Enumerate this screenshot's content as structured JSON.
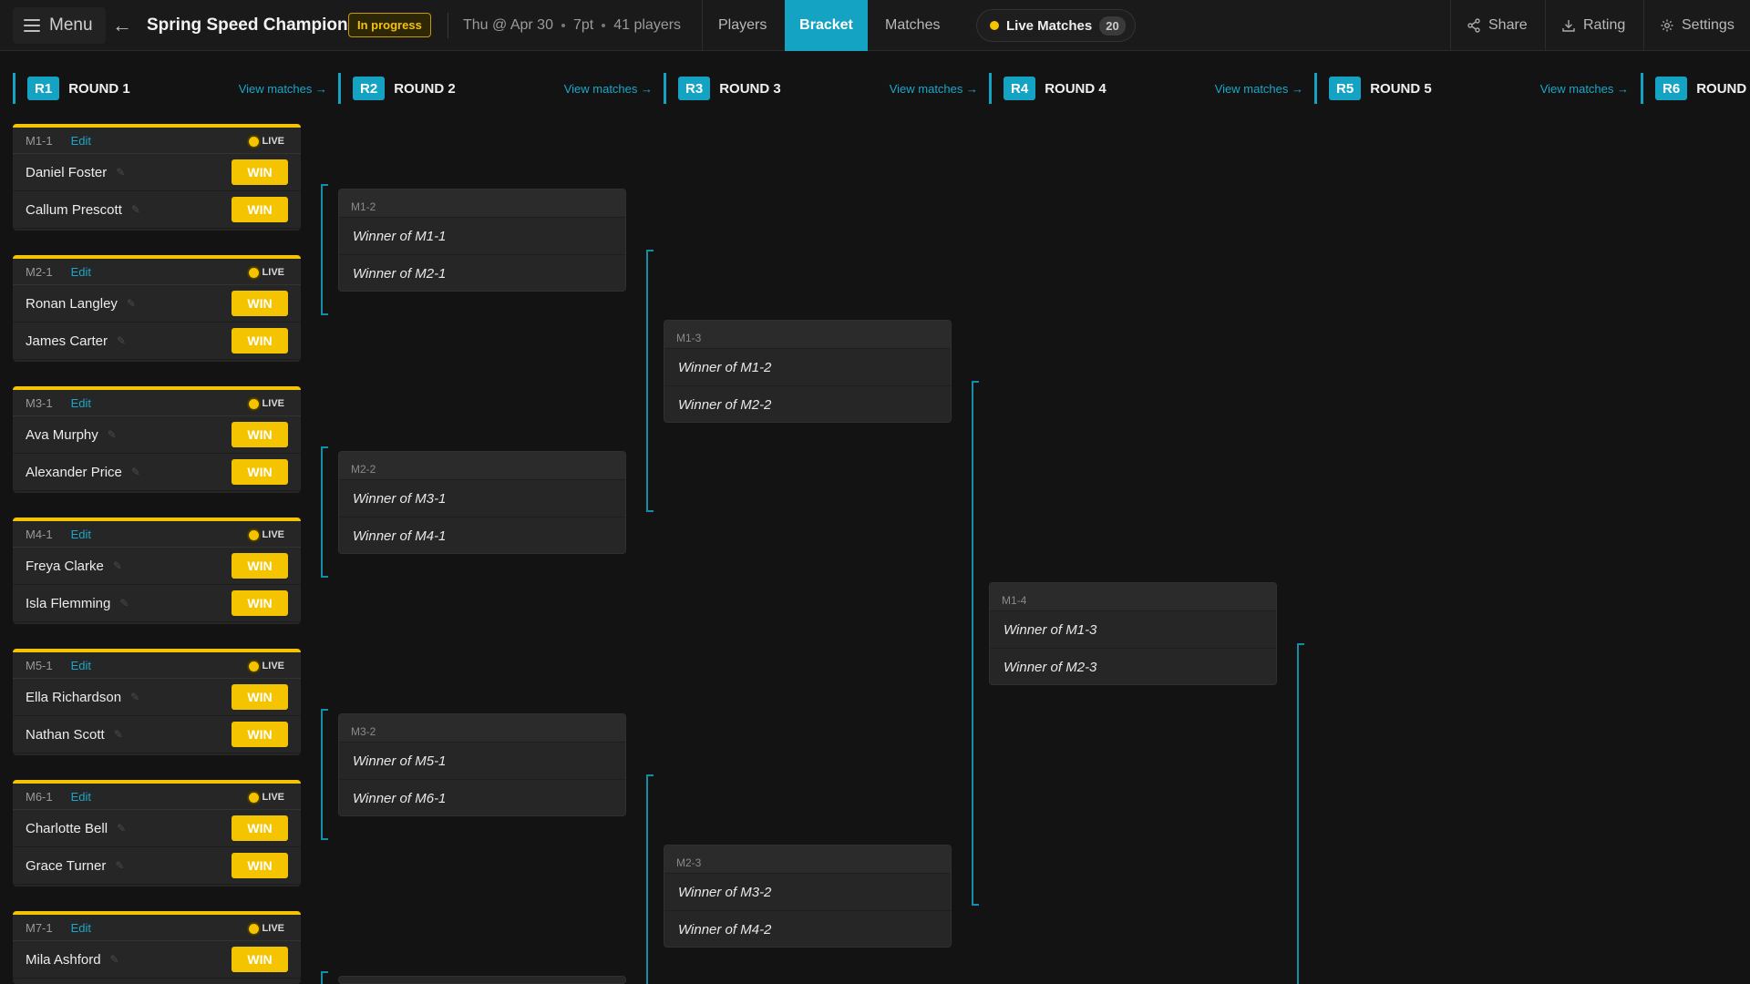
{
  "header": {
    "menu_label": "Menu",
    "back_icon": "arrow-left-icon",
    "title": "Spring Speed Champion",
    "status": "In progress",
    "date": "Thu @ Apr 30",
    "points": "7pt",
    "players": "41 players",
    "tabs": [
      "Players",
      "Bracket",
      "Matches"
    ],
    "active_tab": "Bracket",
    "live_label": "Live Matches",
    "live_count": "20",
    "share_label": "Share",
    "rating_label": "Rating",
    "settings_label": "Settings"
  },
  "colors": {
    "accent": "#15a3c4",
    "live": "#f5c400",
    "background": "#131313",
    "card": "#262626"
  },
  "rounds": [
    {
      "tag": "R1",
      "name": "ROUND 1",
      "view": "View matches →"
    },
    {
      "tag": "R2",
      "name": "ROUND 2",
      "view": "View matches →"
    },
    {
      "tag": "R3",
      "name": "ROUND 3",
      "view": "View matches →"
    },
    {
      "tag": "R4",
      "name": "ROUND 4",
      "view": "View matches →"
    },
    {
      "tag": "R5",
      "name": "ROUND 5",
      "view": "View matches →"
    },
    {
      "tag": "R6",
      "name": "ROUND"
    }
  ],
  "round1_matches": [
    {
      "id": "M1-1",
      "edit": "Edit",
      "live": "LIVE",
      "win": "WIN",
      "players": [
        "Daniel Foster",
        "Callum Prescott"
      ]
    },
    {
      "id": "M2-1",
      "edit": "Edit",
      "live": "LIVE",
      "win": "WIN",
      "players": [
        "Ronan Langley",
        "James Carter"
      ]
    },
    {
      "id": "M3-1",
      "edit": "Edit",
      "live": "LIVE",
      "win": "WIN",
      "players": [
        "Ava Murphy",
        "Alexander Price"
      ]
    },
    {
      "id": "M4-1",
      "edit": "Edit",
      "live": "LIVE",
      "win": "WIN",
      "players": [
        "Freya Clarke",
        "Isla Flemming"
      ]
    },
    {
      "id": "M5-1",
      "edit": "Edit",
      "live": "LIVE",
      "win": "WIN",
      "players": [
        "Ella Richardson",
        "Nathan Scott"
      ]
    },
    {
      "id": "M6-1",
      "edit": "Edit",
      "live": "LIVE",
      "win": "WIN",
      "players": [
        "Charlotte Bell",
        "Grace Turner"
      ]
    },
    {
      "id": "M7-1",
      "edit": "Edit",
      "live": "LIVE",
      "win": "WIN",
      "players": [
        "Mila Ashford"
      ]
    }
  ],
  "round2_matches": [
    {
      "id": "M1-2",
      "slots": [
        "Winner of M1-1",
        "Winner of M2-1"
      ]
    },
    {
      "id": "M2-2",
      "slots": [
        "Winner of M3-1",
        "Winner of M4-1"
      ]
    },
    {
      "id": "M3-2",
      "slots": [
        "Winner of M5-1",
        "Winner of M6-1"
      ]
    }
  ],
  "round3_matches": [
    {
      "id": "M1-3",
      "slots": [
        "Winner of M1-2",
        "Winner of M2-2"
      ]
    },
    {
      "id": "M2-3",
      "slots": [
        "Winner of M3-2",
        "Winner of M4-2"
      ]
    }
  ],
  "round4_matches": [
    {
      "id": "M1-4",
      "slots": [
        "Winner of M1-3",
        "Winner of M2-3"
      ]
    }
  ]
}
